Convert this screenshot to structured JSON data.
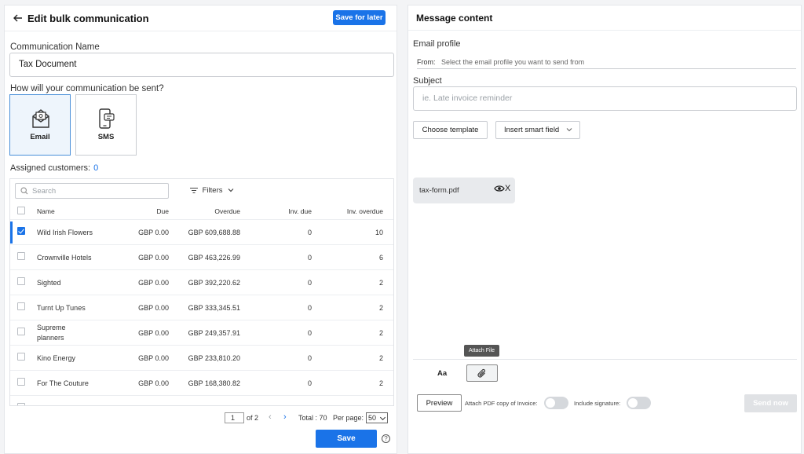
{
  "left": {
    "title": "Edit bulk communication",
    "save_later_label": "Save for later",
    "comm_name_label": "Communication Name",
    "comm_name_value": "Tax Document",
    "send_mode_question": "How will your communication be sent?",
    "modes": [
      {
        "label": "Email",
        "icon": "email-icon",
        "selected": true
      },
      {
        "label": "SMS",
        "icon": "sms-icon",
        "selected": false
      }
    ],
    "assigned_label": "Assigned customers:",
    "assigned_count": "0",
    "search_placeholder": "Search",
    "filters_label": "Filters",
    "columns": [
      "Name",
      "Due",
      "Overdue",
      "Inv. due",
      "Inv. overdue"
    ],
    "rows": [
      {
        "name": "Wild Irish Flowers",
        "due": "GBP 0.00",
        "overdue": "GBP 609,688.88",
        "inv_due": "0",
        "inv_overdue": "10",
        "checked": true
      },
      {
        "name": "Crownville Hotels",
        "due": "GBP 0.00",
        "overdue": "GBP 463,226.99",
        "inv_due": "0",
        "inv_overdue": "6",
        "checked": false
      },
      {
        "name": "Sighted",
        "due": "GBP 0.00",
        "overdue": "GBP 392,220.62",
        "inv_due": "0",
        "inv_overdue": "2",
        "checked": false
      },
      {
        "name": "Turnt Up Tunes",
        "due": "GBP 0.00",
        "overdue": "GBP 333,345.51",
        "inv_due": "0",
        "inv_overdue": "2",
        "checked": false
      },
      {
        "name": "Supreme planners",
        "due": "GBP 0.00",
        "overdue": "GBP 249,357.91",
        "inv_due": "0",
        "inv_overdue": "2",
        "checked": false
      },
      {
        "name": "Kino Energy",
        "due": "GBP 0.00",
        "overdue": "GBP 233,810.20",
        "inv_due": "0",
        "inv_overdue": "2",
        "checked": false
      },
      {
        "name": "For The Couture",
        "due": "GBP 0.00",
        "overdue": "GBP 168,380.82",
        "inv_due": "0",
        "inv_overdue": "2",
        "checked": false
      }
    ],
    "pager": {
      "page": "1",
      "of_label": "of 2",
      "prev": "‹",
      "next": "›",
      "total_label": "Total : 70",
      "per_page_label": "Per page:",
      "per_page_value": "50"
    },
    "save_label": "Save",
    "help_label": "?"
  },
  "right": {
    "title": "Message content",
    "email_profile_label": "Email profile",
    "from_label": "From:",
    "from_placeholder": "Select the email profile you want to send from",
    "subject_label": "Subject",
    "subject_placeholder": "ie. Late invoice reminder",
    "choose_template_label": "Choose template",
    "insert_smart_field_label": "Insert smart field",
    "attachment_name": "tax-form.pdf",
    "attachment_remove": "X",
    "tooltip_label": "Attach File",
    "font_label": "Aa",
    "preview_label": "Preview",
    "attach_pdf_label": "Attach PDF copy of Invoice:",
    "include_signature_label": "Include signature:",
    "send_now_label": "Send now"
  }
}
